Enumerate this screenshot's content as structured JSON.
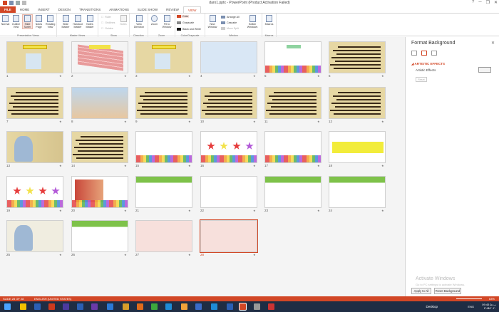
{
  "window": {
    "title": "daro1.pptx - PowerPoint (Product Activation Failed)",
    "help": "?",
    "minimize": "─",
    "restore": "❐",
    "close": "✕"
  },
  "tabs": [
    "FILE",
    "HOME",
    "INSERT",
    "DESIGN",
    "TRANSITIONS",
    "ANIMATIONS",
    "SLIDE SHOW",
    "REVIEW",
    "VIEW"
  ],
  "ribbon": {
    "presentation_views": {
      "label": "Presentation Views",
      "buttons": [
        "Normal",
        "Outline View",
        "Slide Sorter",
        "Notes Page",
        "Reading View"
      ]
    },
    "master_views": {
      "label": "Master Views",
      "buttons": [
        "Slide Master",
        "Handout Master",
        "Notes Master"
      ]
    },
    "show": {
      "label": "Show",
      "items": [
        "Ruler",
        "Gridlines",
        "Guides"
      ],
      "notes": "Notes"
    },
    "direction": {
      "label": "Direction",
      "button": "View Direction"
    },
    "zoom": {
      "label": "Zoom",
      "buttons": [
        "Zoom",
        "Fit to Window"
      ]
    },
    "color": {
      "label": "Color/Grayscale",
      "items": [
        "Color",
        "Grayscale",
        "Black and White"
      ]
    },
    "window_group": {
      "label": "Window",
      "new_window": "New Window",
      "items": [
        "Arrange All",
        "Cascade",
        "Move Split"
      ],
      "switch": "Switch Windows"
    },
    "macros": {
      "label": "Macros",
      "button": "Macros"
    }
  },
  "slides": [
    {
      "num": "1",
      "style": "paper-title"
    },
    {
      "num": "2",
      "style": "brick"
    },
    {
      "num": "3",
      "style": "paper-bell"
    },
    {
      "num": "4",
      "style": "blue"
    },
    {
      "num": "5",
      "style": "rainbow"
    },
    {
      "num": "6",
      "style": "paper-text"
    },
    {
      "num": "7",
      "style": "paper-text"
    },
    {
      "num": "8",
      "style": "kids"
    },
    {
      "num": "9",
      "style": "paper-text"
    },
    {
      "num": "10",
      "style": "paper-text"
    },
    {
      "num": "11",
      "style": "paper-text"
    },
    {
      "num": "12",
      "style": "paper-text"
    },
    {
      "num": "13",
      "style": "girl"
    },
    {
      "num": "14",
      "style": "paper-text"
    },
    {
      "num": "15",
      "style": "rainbow-text"
    },
    {
      "num": "16",
      "style": "stars"
    },
    {
      "num": "17",
      "style": "rainbow-text"
    },
    {
      "num": "18",
      "style": "yellow-box"
    },
    {
      "num": "19",
      "style": "rainbow-stars"
    },
    {
      "num": "20",
      "style": "pink-rainbow"
    },
    {
      "num": "21",
      "style": "green-text"
    },
    {
      "num": "22",
      "style": "white-text"
    },
    {
      "num": "23",
      "style": "green-text"
    },
    {
      "num": "24",
      "style": "green-text"
    },
    {
      "num": "25",
      "style": "girl-light"
    },
    {
      "num": "26",
      "style": "green-text"
    },
    {
      "num": "27",
      "style": "pink-text"
    },
    {
      "num": "28",
      "style": "pink-text",
      "selected": true
    }
  ],
  "panel": {
    "title": "Format Background",
    "section": "ARTISTIC EFFECTS",
    "effects_label": "Artistic Effects",
    "reset": "Reset",
    "apply_all": "Apply to All",
    "reset_background": "Reset Background"
  },
  "watermark": {
    "title": "Activate Windows",
    "subtitle": "Go to PC settings to activate Windows."
  },
  "status": {
    "slide": "SLIDE 28 OF 28",
    "language": "ENGLISH (UNITED STATES)",
    "zoom": "63%"
  },
  "taskbar": {
    "desktop": "Desktop",
    "lang": "ENG",
    "time": "09:45 ب.ظ",
    "date": "۲۱/۵/۲۰۲۰"
  },
  "colors": {
    "accent": "#d24726",
    "taskbar": "#1f2d44"
  }
}
